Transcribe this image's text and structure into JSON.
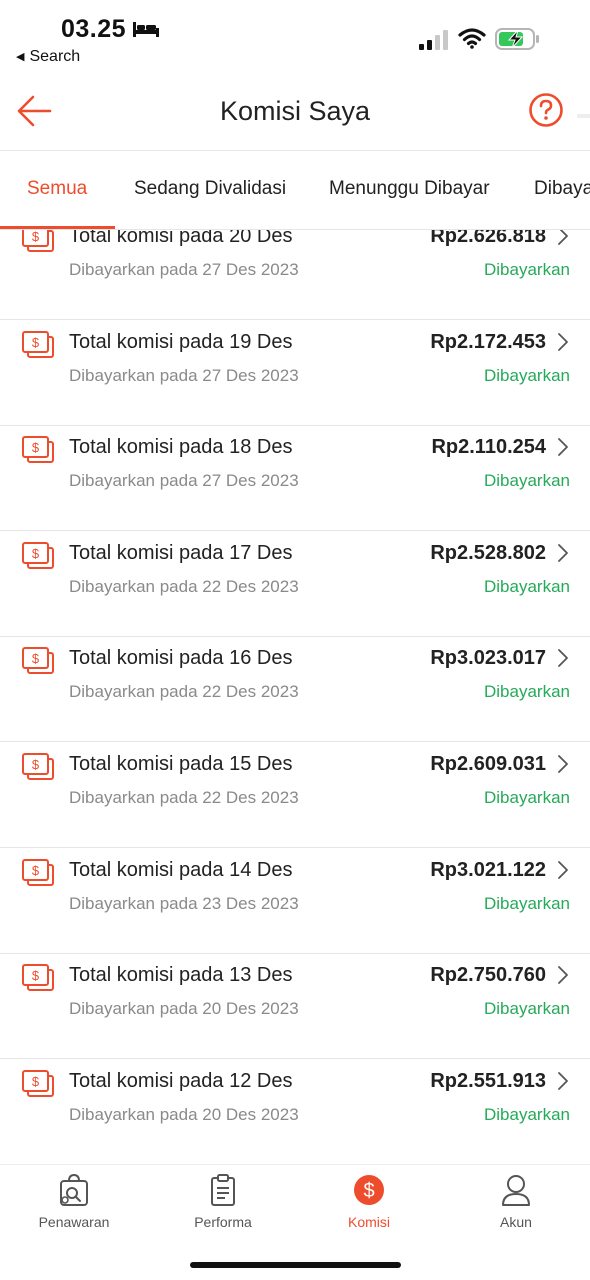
{
  "status_bar": {
    "time": "03.25",
    "back_label": "Search",
    "colors": {
      "battery_fill": "#34c759"
    }
  },
  "header": {
    "title": "Komisi Saya",
    "back_icon": "arrow-left-icon",
    "help_icon": "question-circle-icon"
  },
  "tabs": [
    {
      "label": "Semua",
      "active": true
    },
    {
      "label": "Sedang Divalidasi",
      "active": false
    },
    {
      "label": "Menunggu Dibayar",
      "active": false
    },
    {
      "label": "Dibayarkan",
      "active": false
    }
  ],
  "commissions": [
    {
      "title": "Total komisi pada 20 Des",
      "paid_on": "Dibayarkan pada 27 Des 2023",
      "amount": "Rp2.626.818",
      "status": "Dibayarkan"
    },
    {
      "title": "Total komisi pada 19 Des",
      "paid_on": "Dibayarkan pada 27 Des 2023",
      "amount": "Rp2.172.453",
      "status": "Dibayarkan"
    },
    {
      "title": "Total komisi pada 18 Des",
      "paid_on": "Dibayarkan pada 27 Des 2023",
      "amount": "Rp2.110.254",
      "status": "Dibayarkan"
    },
    {
      "title": "Total komisi pada 17 Des",
      "paid_on": "Dibayarkan pada 22 Des 2023",
      "amount": "Rp2.528.802",
      "status": "Dibayarkan"
    },
    {
      "title": "Total komisi pada 16 Des",
      "paid_on": "Dibayarkan pada 22 Des 2023",
      "amount": "Rp3.023.017",
      "status": "Dibayarkan"
    },
    {
      "title": "Total komisi pada 15 Des",
      "paid_on": "Dibayarkan pada 22 Des 2023",
      "amount": "Rp2.609.031",
      "status": "Dibayarkan"
    },
    {
      "title": "Total komisi pada 14 Des",
      "paid_on": "Dibayarkan pada 23 Des 2023",
      "amount": "Rp3.021.122",
      "status": "Dibayarkan"
    },
    {
      "title": "Total komisi pada 13 Des",
      "paid_on": "Dibayarkan pada 20 Des 2023",
      "amount": "Rp2.750.760",
      "status": "Dibayarkan"
    },
    {
      "title": "Total komisi pada 12 Des",
      "paid_on": "Dibayarkan pada 20 Des 2023",
      "amount": "Rp2.551.913",
      "status": "Dibayarkan"
    }
  ],
  "bottom_nav": [
    {
      "label": "Penawaran",
      "icon": "offer-bag-icon",
      "active": false
    },
    {
      "label": "Performa",
      "icon": "clipboard-icon",
      "active": false
    },
    {
      "label": "Komisi",
      "icon": "dollar-circle-icon",
      "active": true
    },
    {
      "label": "Akun",
      "icon": "user-icon",
      "active": false
    }
  ],
  "colors": {
    "accent": "#ee4d2d",
    "status_paid": "#26aa5a",
    "secondary_text": "#8a8a8a"
  }
}
